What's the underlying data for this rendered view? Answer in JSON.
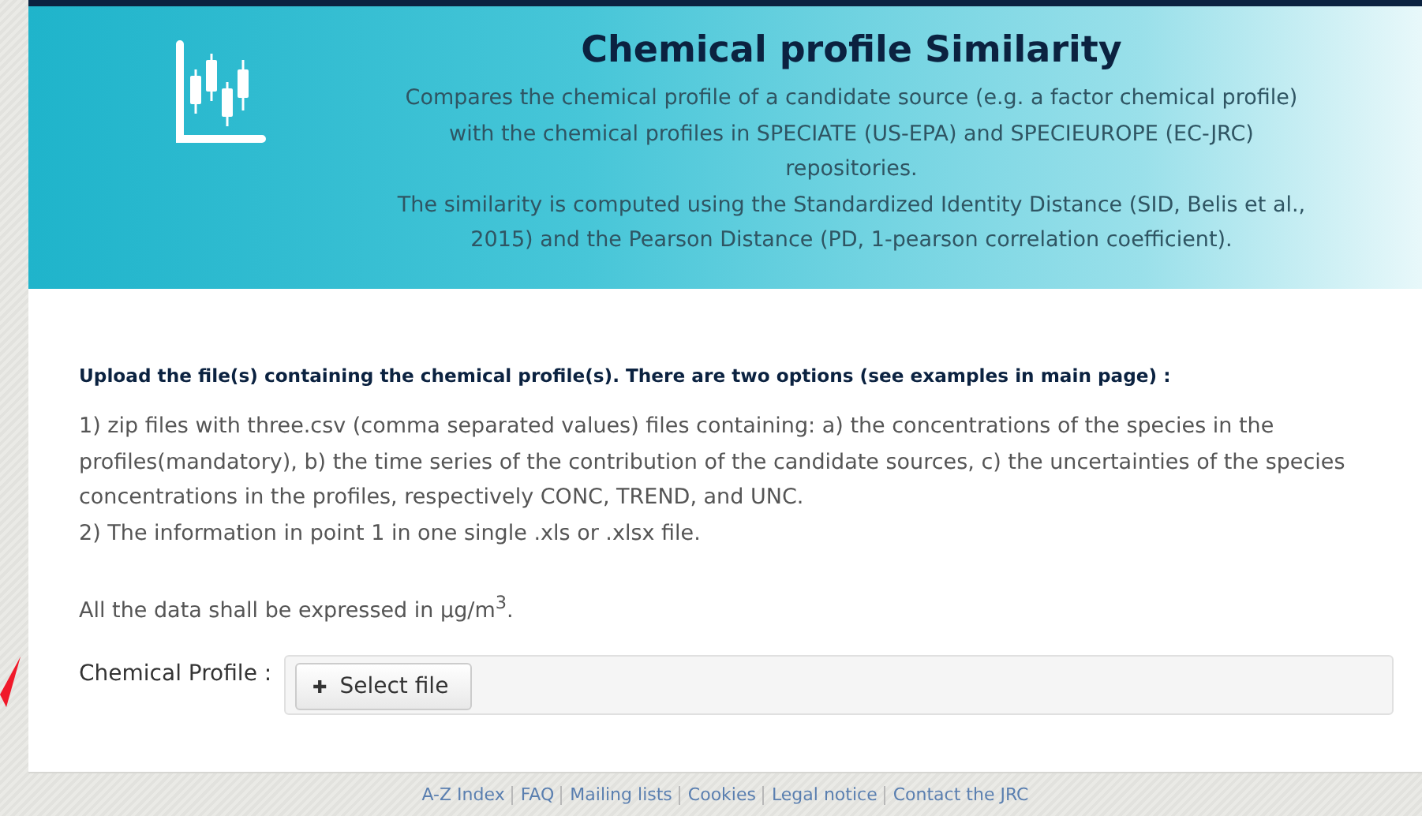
{
  "header": {
    "title": "Chemical profile Similarity",
    "description": [
      "Compares the chemical profile of a candidate source (e.g. a factor chemical profile) with the chemical profiles in SPECIATE (US-EPA) and SPECIEUROPE (EC-JRC) repositories.",
      "The similarity is computed using the Standardized Identity Distance (SID, Belis et al., 2015) and the Pearson Distance (PD, 1-pearson correlation coefficient)."
    ]
  },
  "upload": {
    "heading": "Upload the file(s) containing the chemical profile(s). There are two options (see examples in main page) :",
    "options": [
      "1) zip files with three.csv (comma separated values) files containing: a) the concentrations of the species in the profiles(mandatory), b) the time series of the contribution of the candidate sources, c) the uncertainties of the species concentrations in the profiles, respectively CONC, TREND, and UNC.",
      "2) The information in point 1 in one single .xls or .xlsx file."
    ],
    "note": "All the data shall be expressed in µg/m$^{3}$.",
    "field_label": "Chemical Profile :",
    "button_icon": "✚",
    "button": "Select file"
  },
  "footer_links": [
    "A-Z Index",
    "FAQ",
    "Mailing lists",
    "Cookies",
    "Legal notice",
    "Contact the JRC"
  ]
}
